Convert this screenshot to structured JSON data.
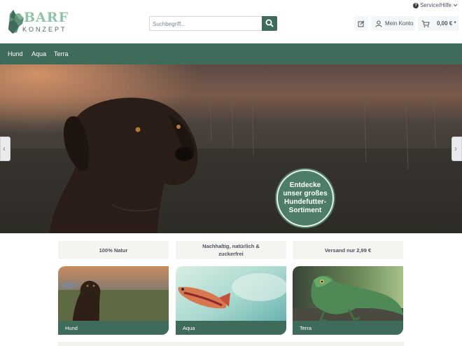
{
  "header": {
    "logo_text": "BARF",
    "logo_subtext": "KONZEPT",
    "service_label": "Service/Hilfe",
    "search_placeholder": "Suchbegriff...",
    "account_label": "Mein Konto",
    "cart_total": "0,00 € *"
  },
  "nav": {
    "items": [
      {
        "label": "Hund"
      },
      {
        "label": "Aqua"
      },
      {
        "label": "Terra"
      }
    ]
  },
  "hero": {
    "badge_text": "Entdecke unser großes Hundefutter-Sortiment",
    "prev_icon": "chevron-left-icon",
    "next_icon": "chevron-right-icon"
  },
  "usps": [
    {
      "text": "100% Natur"
    },
    {
      "text": "Nachhaltig, natürlich & zuckerfrei"
    },
    {
      "text": "Versand nur 2,99 €"
    }
  ],
  "categories": [
    {
      "label": "Hund"
    },
    {
      "label": "Aqua"
    },
    {
      "label": "Terra"
    }
  ],
  "colors": {
    "brand_green": "#3f6b5a",
    "badge_green": "#4d7d67",
    "logo_mint": "#8fc4a8"
  }
}
